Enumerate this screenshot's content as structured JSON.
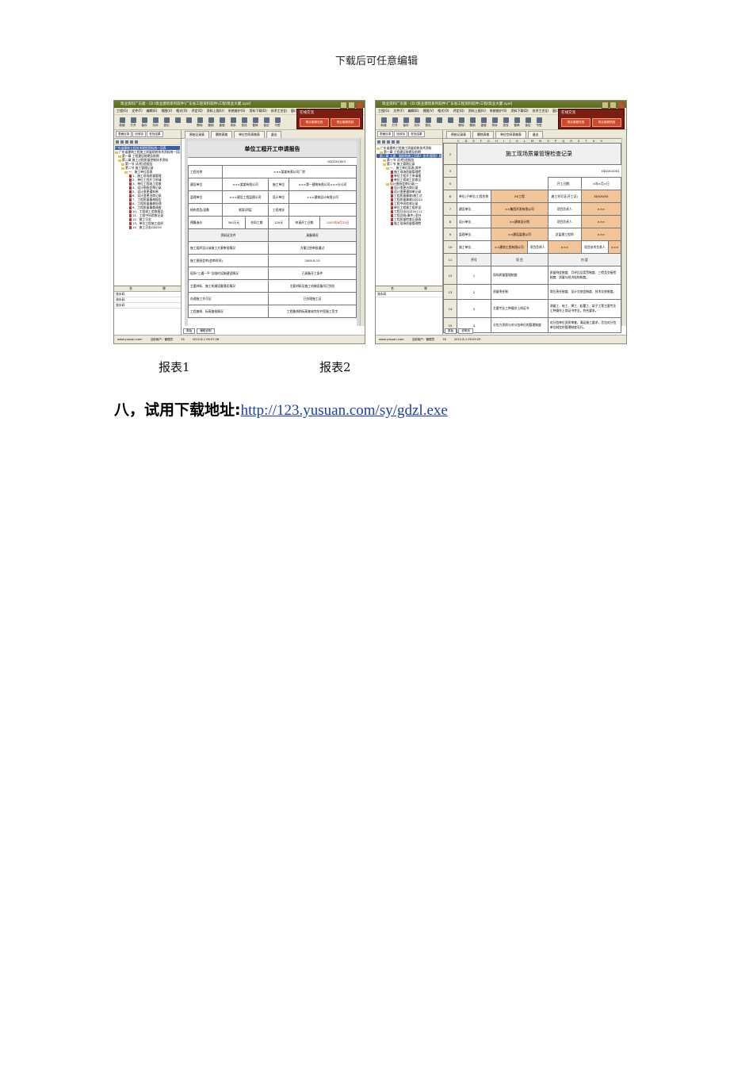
{
  "header_note": "下载后可任意编辑",
  "screenshots": [
    {
      "title": "筑业资料广东版 - [D:\\筑业建筑系列软件\\广东省工程资料软件\\工程\\筑业大厦.zyxl]",
      "menu": [
        "工程(G)",
        "文件(F)",
        "编辑(E)",
        "视图(V)",
        "格式(O)",
        "评定(Q)",
        "资料上报(U)",
        "系统维护(S)",
        "资料下载(D)",
        "技术工艺(J)",
        "窗口(W)",
        "帮助(H)"
      ],
      "toolbar": [
        "新建",
        "打开",
        "保存",
        "另存",
        "退出",
        "",
        "",
        "删除",
        "撤销",
        "重做",
        "排序",
        "查找",
        "替换",
        "锁定",
        "书签"
      ],
      "promo_title": "在线交流",
      "promo_buttons": [
        "筑业客服在线",
        "筑业客服热线"
      ],
      "left_tabs": [
        "表格目录",
        "回收站",
        "查找结果"
      ],
      "tree": [
        {
          "level": 0,
          "kind": "path",
          "text": "广东省建筑工程技术规程资料统一用表"
        },
        {
          "level": 0,
          "kind": "fold",
          "text": "广东省建筑工程施工质量验收技术资料统一用表"
        },
        {
          "level": 1,
          "kind": "fold",
          "text": "第一章 工程建设前期及前期"
        },
        {
          "level": 1,
          "kind": "fold",
          "text": "第二章 施工过程质量控制技术资料"
        },
        {
          "level": 2,
          "kind": "fold",
          "text": "第一节 试(检)验报告"
        },
        {
          "level": 2,
          "kind": "fold",
          "text": "第二节 施工管理记录"
        },
        {
          "level": 3,
          "kind": "fold",
          "text": "一、施工单位用表"
        },
        {
          "level": 4,
          "kind": "doc",
          "text": "1、施工现场质量管理"
        },
        {
          "level": 4,
          "kind": "doc",
          "text": "2、单位工程开工申请"
        },
        {
          "level": 4,
          "kind": "doc",
          "text": "3、单位工程竣工验收"
        },
        {
          "level": 4,
          "kind": "doc",
          "text": "4、设计图纸会审记录"
        },
        {
          "level": 4,
          "kind": "doc",
          "text": "5、设计变更通知单"
        },
        {
          "level": 4,
          "kind": "doc",
          "text": "6、设计变更洽商记录"
        },
        {
          "level": 4,
          "kind": "doc",
          "text": "7、工程质量事故报告"
        },
        {
          "level": 4,
          "kind": "doc",
          "text": "8、工程质量事故处理"
        },
        {
          "level": 4,
          "kind": "doc",
          "text": "9、工程质量事故调查"
        },
        {
          "level": 4,
          "kind": "doc",
          "text": "10、工程竣工验收报告"
        },
        {
          "level": 4,
          "kind": "doc",
          "text": "11、工程中间验收记录"
        },
        {
          "level": 4,
          "kind": "doc",
          "text": "12、施工日志"
        },
        {
          "level": 4,
          "kind": "doc",
          "text": "13、单位工程施工组织"
        },
        {
          "level": 4,
          "kind": "doc",
          "text": "14、施工日志GD220"
        }
      ],
      "props_head": [
        "名",
        "称"
      ],
      "props_rows": [
        "流水码",
        "流水码",
        "流水码"
      ],
      "right_tabs": [
        "原始记录表",
        "删除表格",
        "单位空间表格表",
        "退出"
      ],
      "form_title": "单位工程开工申请报告",
      "form_code": "GD2201003",
      "form_rows": [
        [
          "工程名称",
          "×××某某有限公司厂房"
        ],
        [
          "建设单位",
          "×××某某有限公司",
          "施工单位",
          "×××第一建筑有限公司×××分公司"
        ],
        [
          "监理单位",
          "×××建设工程监理公司",
          "设计单位",
          "×××建筑设计有限公司"
        ],
        [
          "结构类型/层数",
          "框架/四层",
          "工程地址",
          ""
        ],
        [
          "预算造价",
          "300万元",
          "合同工期",
          "120天",
          "申请开工日期",
          "2005年8月25日"
        ],
        [
          "资料证文件",
          "具备情况"
        ],
        [
          "施工组织设计或施工方案审批情况",
          "方案已经审批通过"
        ],
        [
          "施工图纸会审(会审时间)",
          "2005.8.15"
        ],
        [
          "现场“三通一平”及临时设施建设情况",
          "已具备开工条件"
        ],
        [
          "主要材料、施工机械设备落实情况",
          "主要材料及施工机械设备均已到位"
        ],
        [
          "办理施工许可证",
          "已办理施工证"
        ],
        [
          "工程基线、标高复核情况",
          "工程基线和标高复核完毕并签施工签字"
        ]
      ],
      "sheet_tabs": [
        "原始",
        "辅助说明"
      ],
      "status": [
        "www.yusuan.com",
        "当前用户：管理员",
        "35",
        "2012-8-1 09:57:28"
      ]
    },
    {
      "title": "筑业资料广东版 - [D:\\筑业建筑系列软件\\广东省工程资料软件\\工程\\筑业大厦.zyxl]",
      "menu": [
        "工程(G)",
        "文件(F)",
        "编辑(E)",
        "视图(V)",
        "格式(O)",
        "评定(Q)",
        "资料上报(U)",
        "系统维护(S)",
        "资料下载(D)",
        "技术工艺(J)",
        "窗口(W)",
        "帮助(H)"
      ],
      "toolbar": [
        "新建",
        "打开",
        "保存",
        "另存",
        "退出",
        "",
        "",
        "删除",
        "撤销",
        "重做",
        "排序",
        "查找",
        "替换",
        "锁定",
        "书签"
      ],
      "promo_title": "在线交流",
      "promo_buttons": [
        "筑业客服在线",
        "筑业客服热线"
      ],
      "left_tabs": [
        "表格目录",
        "回收站",
        "查找结果"
      ],
      "tree": [
        {
          "level": 0,
          "kind": "fold",
          "text": "广东省建筑工程施工质量验收技术资料"
        },
        {
          "level": 1,
          "kind": "fold",
          "text": "第一章 工程建设前期及前期"
        },
        {
          "level": 1,
          "kind": "path",
          "text": "第二章 土建、钢结构施工用表》技术/管理》质量控制资料"
        },
        {
          "level": 2,
          "kind": "fold",
          "text": "第一节 试(检)验报告"
        },
        {
          "level": 2,
          "kind": "fold",
          "text": "第二节 施工管理记录"
        },
        {
          "level": 3,
          "kind": "fold",
          "text": "一、施工单位用表(其中"
        },
        {
          "level": 4,
          "kind": "doc",
          "text": "施工现场质量管理检"
        },
        {
          "level": 4,
          "kind": "doc",
          "text": "单位工程开工申请报"
        },
        {
          "level": 4,
          "kind": "doc",
          "text": "单位工程竣工验收记"
        },
        {
          "level": 3,
          "kind": "fold",
          "text": "设计图纸会审记录(一"
        },
        {
          "level": 4,
          "kind": "doc",
          "text": "设计变更洽商记录"
        },
        {
          "level": 4,
          "kind": "doc",
          "text": "设计变更通知单记录"
        },
        {
          "level": 4,
          "kind": "doc",
          "text": "工程质量事故(施工过"
        },
        {
          "level": 4,
          "kind": "doc",
          "text": "工程质量事故GD220"
        },
        {
          "level": 4,
          "kind": "doc",
          "text": "工程中间验收记录"
        },
        {
          "level": 4,
          "kind": "doc",
          "text": "单位工程施工组织设"
        },
        {
          "level": 4,
          "kind": "doc",
          "text": "工程日志GD220111"
        },
        {
          "level": 4,
          "kind": "doc",
          "text": "工程总结(事件)·室外"
        },
        {
          "level": 4,
          "kind": "doc",
          "text": "工程质量检查记录表"
        },
        {
          "level": 4,
          "kind": "doc",
          "text": "施工现场质量管理检"
        }
      ],
      "props_head": [
        "名",
        "称"
      ],
      "props_rows": [
        "流水码"
      ],
      "right_tabs": [
        "原始记录表",
        "删除表格",
        "单位空间表格表",
        "退出"
      ],
      "col_header": "C D E F G H I J K L M N O P Q R S T U V",
      "form_title": "施工现场质量管理检查记录",
      "form_code": "GD2201001",
      "start_date_label": "开工日期：",
      "start_date_value": "×年×月×日",
      "rows": [
        {
          "n": "6",
          "cells": [
            "单位(子单位)工程名称",
            "XX工程",
            "施工许可证(开工证)",
            "XXXXXXX"
          ]
        },
        {
          "n": "7",
          "cells": [
            "建设单位",
            "××集团开发有限公司",
            "项目负责人",
            "×××"
          ]
        },
        {
          "n": "8",
          "cells": [
            "设计单位",
            "××建筑设计院",
            "项目负责人",
            "×××"
          ]
        },
        {
          "n": "9",
          "cells": [
            "监理单位",
            "××建设监理公司",
            "总监理工程师",
            "×××"
          ]
        },
        {
          "n": "10",
          "cells": [
            "施工单位",
            "××建筑工程有限公司",
            "项目负责人",
            "×××",
            "项目技术负责人",
            "×××"
          ]
        },
        {
          "n": "11",
          "cells": [
            "序号",
            "项 目",
            "内 容"
          ]
        },
        {
          "n": "12",
          "cells": [
            "1",
            "现场质量管理制度",
            "质量例会制度、月评比及奖罚制度、三检及交接检制度、质量与经济挂钩制度。"
          ]
        },
        {
          "n": "13",
          "cells": [
            "2",
            "质量责任制",
            "岗位责任制度、设计交底会制度、技术交底制度。"
          ]
        },
        {
          "n": "14",
          "cells": [
            "3",
            "主要专业工种操作上岗证书",
            "测量工、电工、焊工、起重工、架子工等主要专业工种操作上岗证书齐全，符合要求。"
          ]
        },
        {
          "n": "15",
          "cells": [
            "4",
            "分包方资质与对分包单位的管理制度",
            "对分包单位资质审查，满足施工要求，总包对分包单位制定的管理制度可行。"
          ]
        }
      ],
      "sheet_tabs": [
        "原始",
        "说明页"
      ],
      "status": [
        "www.yusuan.com",
        "当前用户：管理员",
        "76",
        "2012-8-1 09:59:29"
      ]
    }
  ],
  "captions": [
    "报表1",
    "报表2"
  ],
  "section": {
    "label": "八，试用下载地址:",
    "link": "http://123.yusuan.com/sy/gdzl.exe"
  }
}
